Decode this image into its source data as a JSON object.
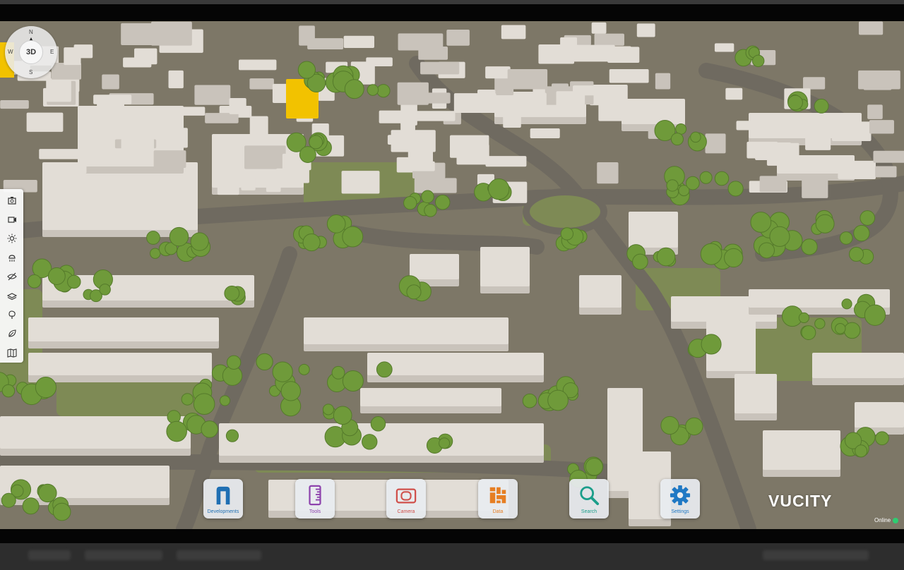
{
  "map": {
    "colors": {
      "ground": "#7d7767",
      "road": "#6f6a60",
      "grass": "#7e8a55",
      "building": "#e2ddd6",
      "building_shade": "#c9c3bb",
      "tree": "#6f9a3a",
      "highlight": "#f2c200"
    }
  },
  "compass": {
    "mode_label": "3D",
    "north": "N",
    "east": "E",
    "south": "S",
    "west": "W"
  },
  "left_toolbar": {
    "tools": [
      {
        "name": "screenshot-icon"
      },
      {
        "name": "video-icon"
      },
      {
        "name": "sun-icon"
      },
      {
        "name": "weather-icon"
      },
      {
        "name": "visibility-icon"
      },
      {
        "name": "layers-icon"
      },
      {
        "name": "trees-icon"
      },
      {
        "name": "leaf-icon"
      },
      {
        "name": "map-icon"
      }
    ]
  },
  "dock": {
    "developments": {
      "label": "Developments",
      "icon": "building-icon",
      "color": "#1f6fb3"
    },
    "tools": {
      "label": "Tools",
      "icon": "ruler-icon",
      "color": "#8e44ad"
    },
    "camera": {
      "label": "Camera",
      "icon": "camera-icon",
      "color": "#d0504b"
    },
    "data": {
      "label": "Data",
      "icon": "data-icon",
      "color": "#e67e22"
    },
    "search": {
      "label": "Search",
      "icon": "search-icon",
      "color": "#1b9e8a"
    },
    "settings": {
      "label": "Settings",
      "icon": "gear-icon",
      "color": "#1f78c4"
    }
  },
  "brand": {
    "logo": "VUCITY"
  },
  "status": {
    "text": "Online",
    "color": "#2ecc71"
  }
}
